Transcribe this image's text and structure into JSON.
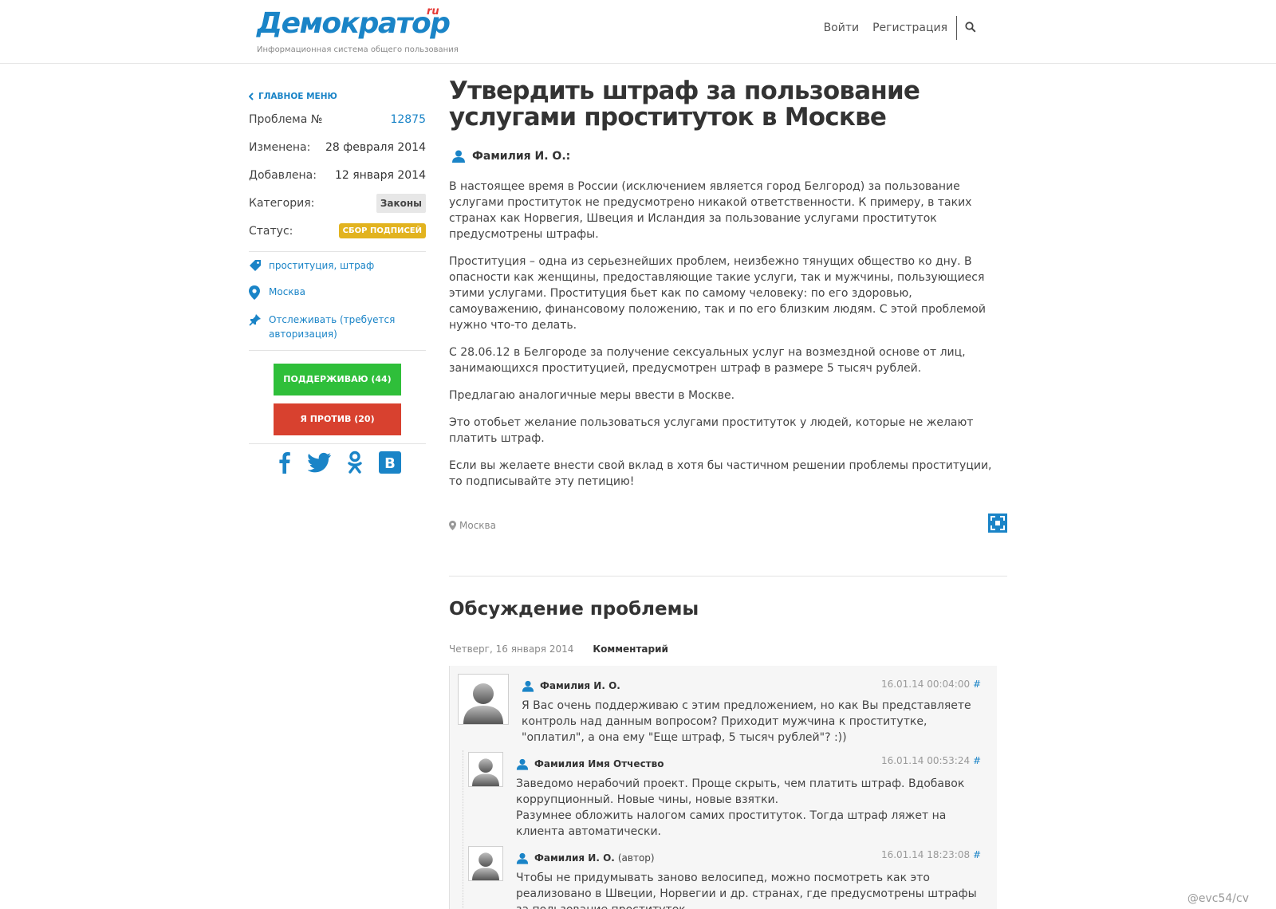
{
  "header": {
    "logo_text": "Демократор",
    "logo_ru": "ru",
    "logo_sub": "Информационная система общего пользования",
    "nav": {
      "login": "Войти",
      "register": "Регистрация"
    }
  },
  "sidebar": {
    "back_link": "Главное меню",
    "meta": [
      {
        "label": "Проблема №",
        "value": "12875"
      },
      {
        "label": "Изменена:",
        "value": "28 февраля 2014"
      },
      {
        "label": "Добавлена:",
        "value": "12 января 2014"
      },
      {
        "label": "Категория:",
        "value": "Законы"
      },
      {
        "label": "Статус:",
        "value": "СБОР ПОДПИСЕЙ"
      }
    ],
    "tags": "проституция, штраф",
    "location": "Москва",
    "track": "Отслеживать (требуется авторизация)",
    "support_button": "ПОДДЕРЖИВАЮ (44)",
    "against_button": "Я ПРОТИВ (20)",
    "social": [
      "facebook-icon",
      "twitter-icon",
      "odnoklassniki-icon",
      "vk-icon"
    ]
  },
  "main": {
    "title": "Утвердить штраф за пользование услугами проституток в Москве",
    "author": "Фамилия И. О.:",
    "paragraphs": [
      "В настоящее время в России (исключением является город Белгород) за пользование услугами проституток не предусмотрено никакой ответственности. К примеру, в таких странах как Норвегия, Швеция и Исландия за пользование услугами проституток предусмотрены штрафы.",
      "Проституция – одна из серьезнейших проблем, неизбежно тянущих общество ко дну. В опасности как женщины, предоставляющие такие услуги, так и мужчины, пользующиеся этими услугами. Проституция бьет как по самому человеку: по его здоровью, самоуважению, финансовому положению, так и по его близким людям. С этой проблемой нужно что-то делать.",
      "С 28.06.12 в Белгороде за получение сексуальных услуг на возмездной основе от лиц, занимающихся проституцией, предусмотрен штраф в размере 5 тысяч рублей.",
      "Предлагаю аналогичные меры ввести в Москве.",
      "Это отобьет желание пользоваться услугами проституток у людей, которые не желают платить штраф.",
      "Если вы желаете внести свой вклад в хотя бы частичном решении проблемы проституции, то подписывайте эту петицию!"
    ],
    "location": "Москва"
  },
  "discussion": {
    "title": "Обсуждение проблемы",
    "date": "Четверг, 16 января 2014",
    "label": "Комментарий",
    "comments": [
      {
        "author": "Фамилия И. О.",
        "note": "",
        "time": "16.01.14 00:04:00",
        "hash": "#",
        "text": "Я Вас очень поддерживаю с этим предложением, но как Вы представляете контроль над данным вопросом? Приходит мужчина к проститутке, \"оплатил\", а она ему \"Еще штраф, 5 тысяч рублей\"? :))"
      },
      {
        "author": "Фамилия Имя Отчество",
        "note": "",
        "time": "16.01.14 00:53:24",
        "hash": "#",
        "text": "Заведомо нерабочий проект. Проще скрыть, чем платить штраф. Вдобавок коррупционный. Новые чины, новые взятки.\nРазумнее обложить налогом самих проституток. Тогда штраф ляжет на клиента автоматически."
      },
      {
        "author": "Фамилия И. О.",
        "note": "(автор)",
        "time": "16.01.14 18:23:08",
        "hash": "#",
        "text": "Чтобы не придумывать заново велосипед, можно посмотреть как это реализовано в Швеции, Норвегии и др. странах, где предусмотрены штрафы за пользование проституток."
      }
    ]
  },
  "watermark": "@evc54/cv",
  "colors": {
    "accent": "#1a84c7",
    "support": "#2fbf3a",
    "against": "#d8412f",
    "status": "#e2b31f"
  }
}
